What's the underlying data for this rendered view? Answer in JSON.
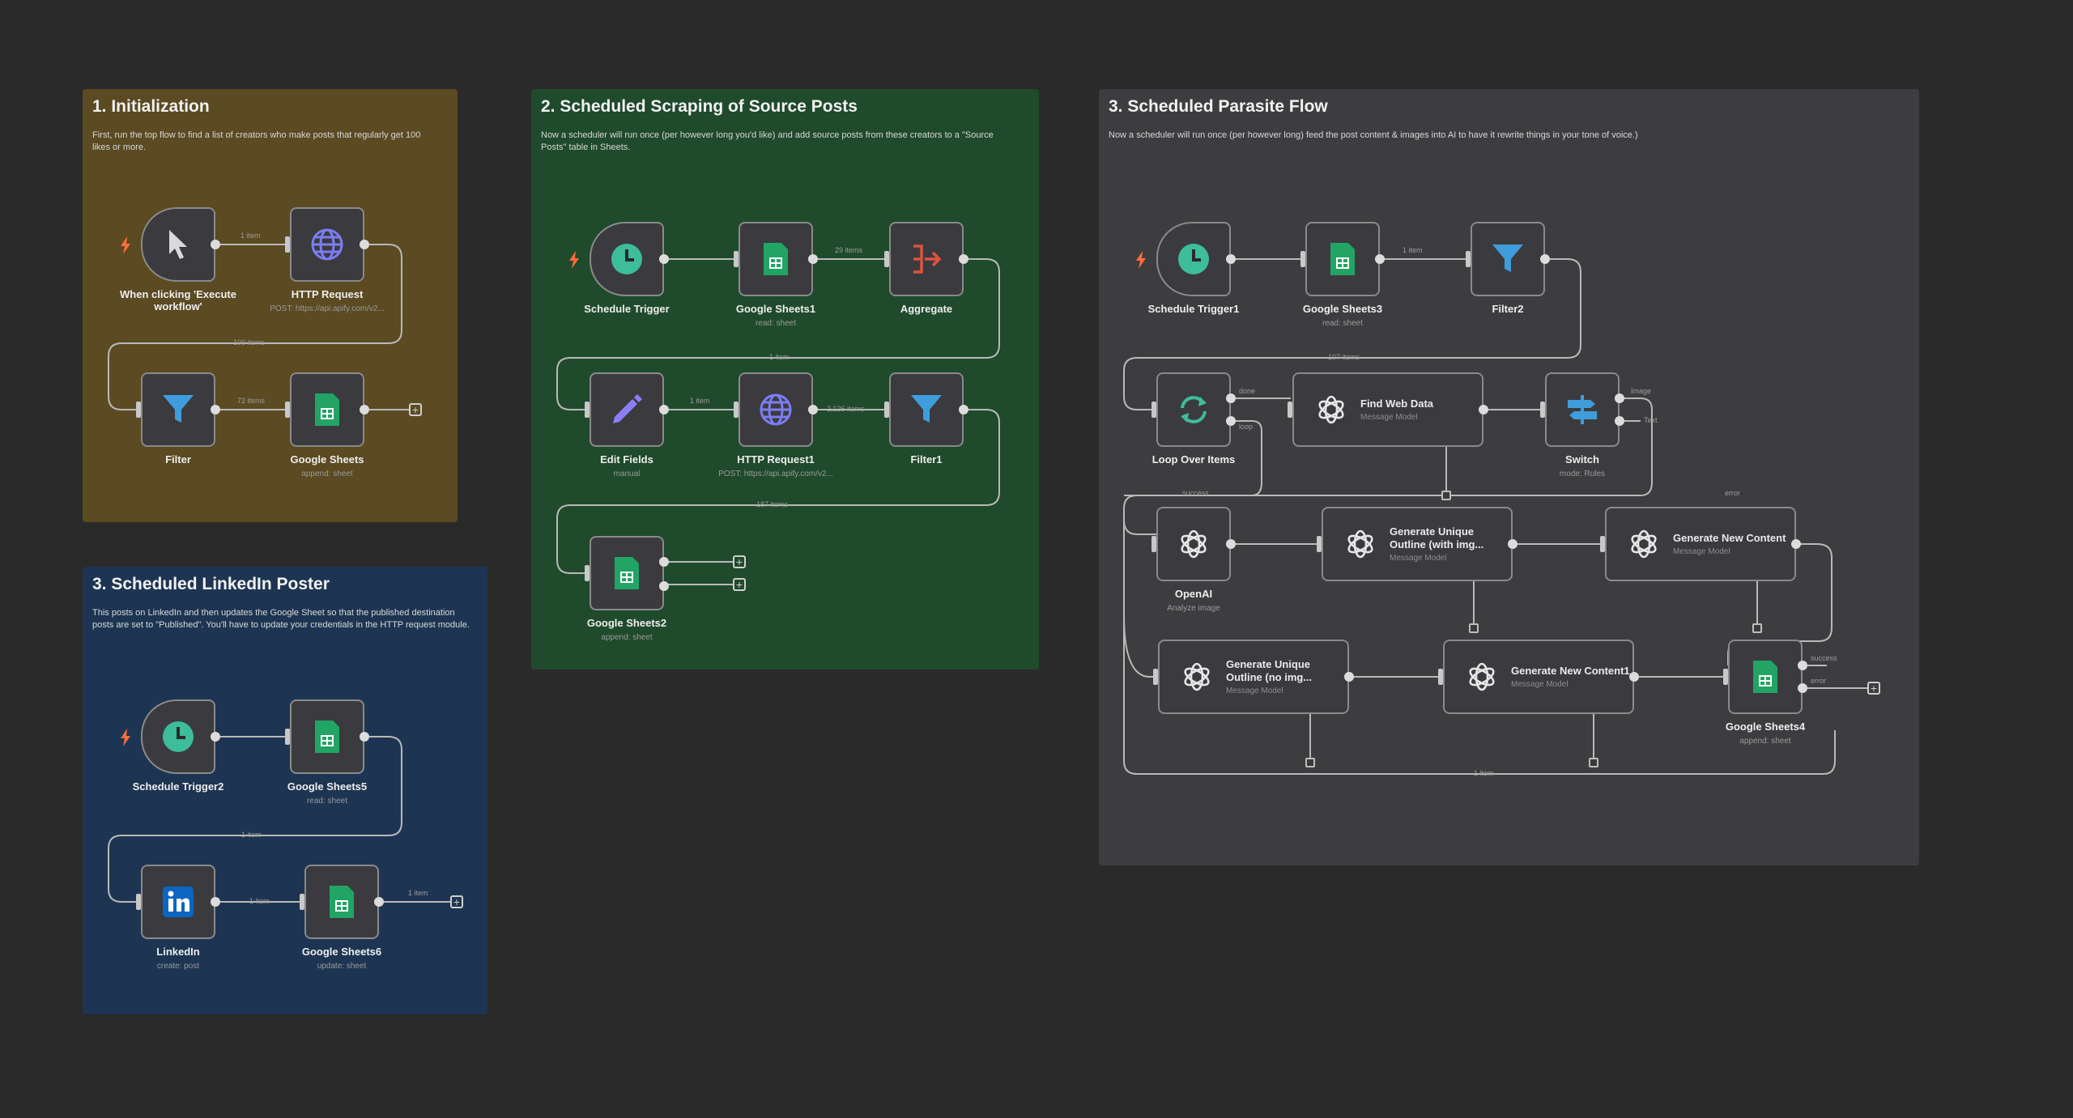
{
  "groups": {
    "init": {
      "title": "1. Initialization",
      "desc": "First, run the top flow to find a list of creators who make posts that regularly get 100 likes or more.",
      "color": "#5b4a22"
    },
    "scraping": {
      "title": "2. Scheduled Scraping of Source Posts",
      "desc": "Now a scheduler will run once (per however long you'd like) and add source posts from these creators to a \"Source Posts\" table in Sheets.",
      "color": "#1f4a2c"
    },
    "parasite": {
      "title": "3. Scheduled Parasite Flow",
      "desc": "Now a scheduler will run once (per however long) feed the post content & images into AI to have it rewrite things in your tone of voice.)",
      "color": "#3d3d40"
    },
    "linkedin": {
      "title": "3. Scheduled LinkedIn Poster",
      "desc": "This posts on LinkedIn and then updates the Google Sheet so that the published destination posts are set to \"Published\". You'll have to update your credentials in the HTTP request module.",
      "color": "#1d3552"
    }
  },
  "nodes": {
    "n1": {
      "label": "When clicking 'Execute workflow'",
      "icon": "cursor-icon"
    },
    "n2": {
      "label": "HTTP Request",
      "sub": "POST: https://api.apify.com/v2...",
      "icon": "globe-icon"
    },
    "n3": {
      "label": "Filter",
      "icon": "filter-icon"
    },
    "n4": {
      "label": "Google Sheets",
      "sub": "append: sheet",
      "icon": "google-sheets-icon"
    },
    "s1": {
      "label": "Schedule Trigger",
      "icon": "clock-icon"
    },
    "s2": {
      "label": "Google Sheets1",
      "sub": "read: sheet",
      "icon": "google-sheets-icon"
    },
    "s3": {
      "label": "Aggregate",
      "icon": "aggregate-icon"
    },
    "s4": {
      "label": "Edit Fields",
      "sub": "manual",
      "icon": "pencil-icon"
    },
    "s5": {
      "label": "HTTP Request1",
      "sub": "POST: https://api.apify.com/v2...",
      "icon": "globe-icon"
    },
    "s6": {
      "label": "Filter1",
      "icon": "filter-icon"
    },
    "s7": {
      "label": "Google Sheets2",
      "sub": "append: sheet",
      "icon": "google-sheets-icon"
    },
    "l1": {
      "label": "Schedule Trigger2",
      "icon": "clock-icon"
    },
    "l2": {
      "label": "Google Sheets5",
      "sub": "read: sheet",
      "icon": "google-sheets-icon"
    },
    "l3": {
      "label": "LinkedIn",
      "sub": "create: post",
      "icon": "linkedin-icon"
    },
    "l4": {
      "label": "Google Sheets6",
      "sub": "update: sheet",
      "icon": "google-sheets-icon"
    },
    "p1": {
      "label": "Schedule Trigger1",
      "icon": "clock-icon"
    },
    "p2": {
      "label": "Google Sheets3",
      "sub": "read: sheet",
      "icon": "google-sheets-icon"
    },
    "p3": {
      "label": "Filter2",
      "icon": "filter-icon"
    },
    "p4": {
      "label": "Loop Over Items",
      "icon": "loop-icon"
    },
    "p5": {
      "label": "Find Web Data",
      "sub": "Message Model",
      "icon": "openai-icon"
    },
    "p6": {
      "label": "Switch",
      "sub": "mode: Rules",
      "icon": "switch-icon"
    },
    "p7": {
      "label": "OpenAI",
      "sub": "Analyze image",
      "icon": "openai-icon"
    },
    "p8": {
      "label": "Generate Unique Outline (with img...",
      "sub": "Message Model",
      "icon": "openai-icon"
    },
    "p9": {
      "label": "Generate New Content",
      "sub": "Message Model",
      "icon": "openai-icon"
    },
    "p10": {
      "label": "Generate Unique Outline (no img...",
      "sub": "Message Model",
      "icon": "openai-icon"
    },
    "p11": {
      "label": "Generate New Content1",
      "sub": "Message Model",
      "icon": "openai-icon"
    },
    "p12": {
      "label": "Google Sheets4",
      "sub": "append: sheet",
      "icon": "google-sheets-icon"
    }
  },
  "edges": {
    "e1": "1 item",
    "e2": "100 items",
    "e3": "72 items",
    "e4": "29 items",
    "e5": "1 item",
    "e6": "1 item",
    "e7": "2,126 items",
    "e8": "187 items",
    "e9": "1 item",
    "e10": "1 item",
    "e11": "1 item",
    "e12": "1 item",
    "e13": "107 items",
    "e14": "1 item",
    "e15": "done",
    "e16": "loop",
    "e17": "Image",
    "e18": "Text",
    "e19": "success",
    "e20": "error",
    "e21": "success",
    "e22": "error"
  },
  "colors": {
    "canvas": "#2a2a2a",
    "node_bg": "#3b3b3f",
    "trigger_green": "#3dbd9a",
    "sheets_green": "#21a464",
    "filter_blue": "#3f9ddc",
    "aggregate_red": "#e0533f",
    "globe_purple": "#7b7df2",
    "linkedin_blue": "#0a66c2",
    "bolt_orange": "#ff6d3a"
  }
}
